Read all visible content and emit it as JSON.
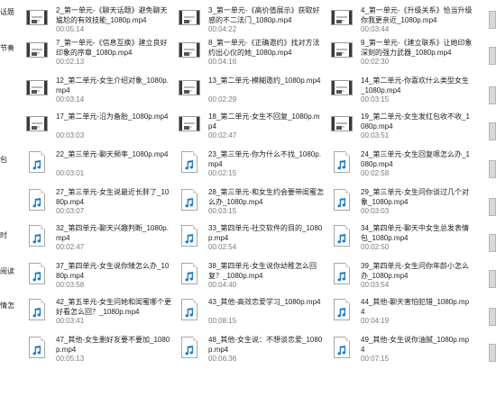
{
  "left_clipped": [
    "话题",
    "节奏",
    "",
    "",
    "包",
    "",
    "",
    "时",
    "",
    "阅读",
    "情怎",
    "",
    ""
  ],
  "icons": {
    "video": "video-thumbnail-icon",
    "audio": "audio-file-icon"
  },
  "files": [
    {
      "name": "2_第一单元-《聊天话题》避免聊天尴尬的有效技能_1080p.mp4",
      "duration": "00:05:14",
      "type": "video"
    },
    {
      "name": "3_第一单元-《高价值展示》获取好感的不二法门_1080p.mp4",
      "duration": "00:04:22",
      "type": "video"
    },
    {
      "name": "4_第一单元-《升级关系》恰当升级你我更亲近_1080p.mp4",
      "duration": "00:03:44",
      "type": "video"
    },
    {
      "name": "7_第一单元-《信息互换》建立良好印象的序章_1080p.mp4",
      "duration": "00:02:13",
      "type": "video"
    },
    {
      "name": "8_第一单元-《正确邀约》找对方法约出心仪的她_1080p.mp4",
      "duration": "00:04:16",
      "type": "video"
    },
    {
      "name": "9_第一单元-《建立联系》让她印象深刻的强力武器_1080p.mp4",
      "duration": "00:02:30",
      "type": "video"
    },
    {
      "name": "12_第二单元-女生介绍对象_1080p.mp4",
      "duration": "00:03:14",
      "type": "video"
    },
    {
      "name": "13_第二单元-模糊邀约_1080p.mp4",
      "duration": "00:02:29",
      "type": "video"
    },
    {
      "name": "14_第二单元-你喜欢什么类型女生_1080p.mp4",
      "duration": "00:03:15",
      "type": "video"
    },
    {
      "name": "17_第二单元-沿为备胎_1080p.mp4",
      "duration": "00:03:03",
      "type": "video"
    },
    {
      "name": "18_第二单元-女生不回复_1080p.mp4",
      "duration": "00:02:47",
      "type": "video"
    },
    {
      "name": "19_第二单元-女生发红包收不收_1080p.mp4",
      "duration": "00:03:51",
      "type": "video"
    },
    {
      "name": "22_第三单元-聊天频率_1080p.mp4",
      "duration": "00:03:01",
      "type": "audio"
    },
    {
      "name": "23_第三单元-你为什么不找_1080p.mp4",
      "duration": "00:02:15",
      "type": "audio"
    },
    {
      "name": "24_第三单元-女生回复嗯怎么办_1080p.mp4",
      "duration": "00:02:58",
      "type": "audio"
    },
    {
      "name": "27_第三单元-女生说最近长胖了_1080p.mp4",
      "duration": "00:03:07",
      "type": "audio"
    },
    {
      "name": "28_第三单元-和女生约会要带闺蜜怎么办_1080p.mp4",
      "duration": "00:03:15",
      "type": "audio"
    },
    {
      "name": "29_第三单元-女生问你谈过几个对象_1080p.mp4",
      "duration": "00:03:03",
      "type": "audio"
    },
    {
      "name": "32_第四单元-聊天兴趣判断_1080p.mp4",
      "duration": "00:02:47",
      "type": "audio"
    },
    {
      "name": "33_第四单元-社交软件的目的_1080p.mp4",
      "duration": "00:02:54",
      "type": "audio"
    },
    {
      "name": "34_第四单元-聊天中女生总发表情包_1080p.mp4",
      "duration": "00:02:50",
      "type": "audio"
    },
    {
      "name": "37_第四单元-女生说你矮怎么办_1080p.mp4",
      "duration": "00:03:58",
      "type": "audio"
    },
    {
      "name": "38_第四单元-女生说你幼稚怎么回复？_1080p.mp4",
      "duration": "00:04:40",
      "type": "audio"
    },
    {
      "name": "39_第四单元-女生问你年龄小怎么办_1080p.mp4",
      "duration": "00:03:54",
      "type": "audio"
    },
    {
      "name": "42_第五单元-女生问她和闺蜜哪个更好看怎么回？_1080p.mp4",
      "duration": "00:03:41",
      "type": "audio"
    },
    {
      "name": "43_其他-高效恋爱学习_1080p.mp4",
      "duration": "00:08:15",
      "type": "audio"
    },
    {
      "name": "44_其他-聊天害怕犯错_1080p.mp4",
      "duration": "00:04:19",
      "type": "audio"
    },
    {
      "name": "47_其他-女生删好友要不要加_1080p.mp4",
      "duration": "00:05:13",
      "type": "audio"
    },
    {
      "name": "48_其他-女生说：不想谈恋爱_1080p.mp4",
      "duration": "00:06:36",
      "type": "audio"
    },
    {
      "name": "49_其他-女生说你油腻_1080p.mp4",
      "duration": "00:07:15",
      "type": "audio"
    }
  ]
}
